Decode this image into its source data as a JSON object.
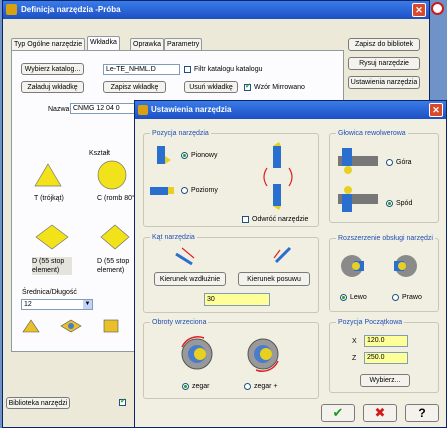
{
  "main_window": {
    "title": "Definicja narzędzia -Próba",
    "tabs": [
      "Typ Ogólne narzędzie",
      "Wkładka",
      "Oprawka",
      "Parametry"
    ],
    "buttons": {
      "select_catalog": "Wybierz katalog...",
      "delete_insert": "Usuń wkładkę",
      "load_insert": "Załaduj wkładkę",
      "save_insert": "Zapisz wkładkę",
      "save_to_library": "Zapisz do bibliotek",
      "draw_tool": "Rysuj narzędzie",
      "tool_settings": "Ustawienia narzędzia",
      "tool_library": "Biblioteka narzędzi"
    },
    "catalog_field": "Le-TE_NHML.D",
    "filter_label": "Filtr katalogu katalogu",
    "mirror_label": "Wzór Mirrowano",
    "name_label": "Nazwa",
    "name_value": "CNMG 12 04 0",
    "shape_header": "Kształt",
    "shapes": [
      "T (trójkąt)",
      "C (romb 80°)",
      "D (55 stop element)",
      "D (55 stop element)"
    ],
    "diameter_label": "Średnica/Długość",
    "diameter_value": "12"
  },
  "dialog": {
    "title": "Ustawienia narzędzia",
    "tool_position": {
      "title": "Pozycja narzędzia",
      "vertical": "Pionowy",
      "horizontal": "Poziomy",
      "flip": "Odwróć narzędzie"
    },
    "cutting_direction": {
      "title": "Kąt narzędzia",
      "btn_axial": "Kierunek wzdłużnie",
      "btn_feed": "Kierunek posuwu",
      "angle_value": "30"
    },
    "spindle_direction": {
      "title": "Obroty wrzeciona",
      "cw": "zegar",
      "ccw": "zegar +"
    },
    "insert_block": {
      "title": "Głowica rewolwerowa",
      "top": "Góra",
      "bottom": "Spód"
    },
    "tool_type": {
      "title": "Rozszerzenie obsługi narzędzi",
      "left": "Lewo",
      "right": "Prawo"
    },
    "start_position": {
      "title": "Pozycja Początkowa",
      "x_label": "X",
      "x_value": "120.0",
      "z_label": "Z",
      "z_value": "250.0",
      "select_btn": "Wybierz..."
    },
    "footer_glyphs": {
      "ok": "✔",
      "cancel": "✖",
      "help": "?"
    }
  }
}
